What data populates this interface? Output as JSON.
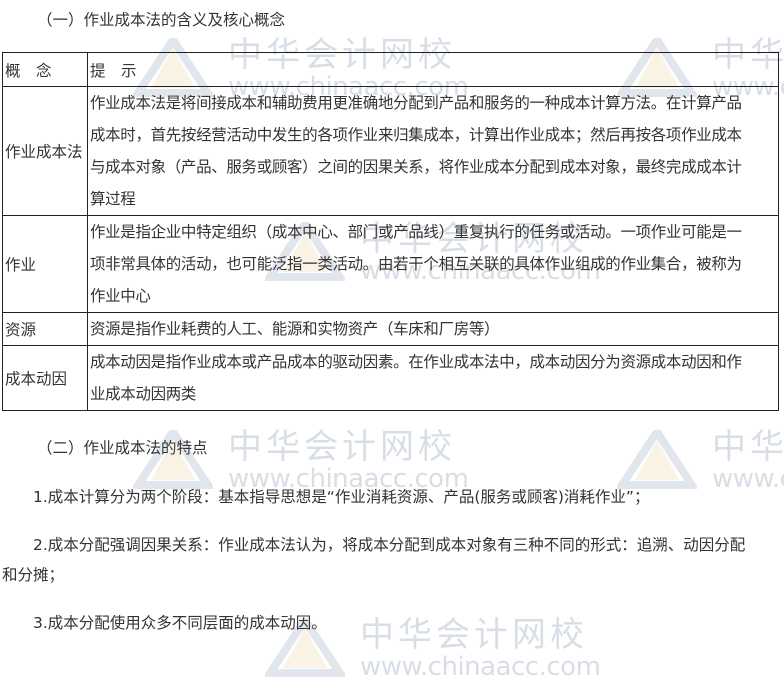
{
  "watermark": {
    "cn": "中华会计网校",
    "en": "www.chinaacc.com"
  },
  "section1_title": "（一）作业成本法的含义及核心概念",
  "table": {
    "headers": [
      "概　念",
      "提　示"
    ],
    "rows": [
      {
        "term": "作业成本法",
        "lines": [
          "作业成本法是将间接成本和辅助费用更准确地分配到产品和服务的一种成本计算方法。在计算产品",
          "成本时，首先按经营活动中发生的各项作业来归集成本，计算出作业成本；然后再按各项作业成本",
          "与成本对象（产品、服务或顾客）之间的因果关系，将作业成本分配到成本对象，最终完成成本计",
          "算过程"
        ]
      },
      {
        "term": "作业",
        "lines": [
          "作业是指企业中特定组织（成本中心、部门或产品线）重复执行的任务或活动。一项作业可能是一",
          "项非常具体的活动，也可能泛指一类活动。由若干个相互关联的具体作业组成的作业集合，被称为",
          "作业中心"
        ]
      },
      {
        "term": "资源",
        "lines": [
          "资源是指作业耗费的人工、能源和实物资产（车床和厂房等）"
        ]
      },
      {
        "term": "成本动因",
        "lines": [
          "成本动因是指作业成本或产品成本的驱动因素。在作业成本法中，成本动因分为资源成本动因和作",
          "业成本动因两类"
        ]
      }
    ]
  },
  "section2_title": "（二）作业成本法的特点",
  "points": [
    "1.成本计算分为两个阶段：基本指导思想是“作业消耗资源、产品(服务或顾客)消耗作业”；",
    "2.成本分配强调因果关系：作业成本法认为，将成本分配到成本对象有三种不同的形式：追溯、动因分配",
    "和分摊；",
    "3.成本分配使用众多不同层面的成本动因。"
  ]
}
